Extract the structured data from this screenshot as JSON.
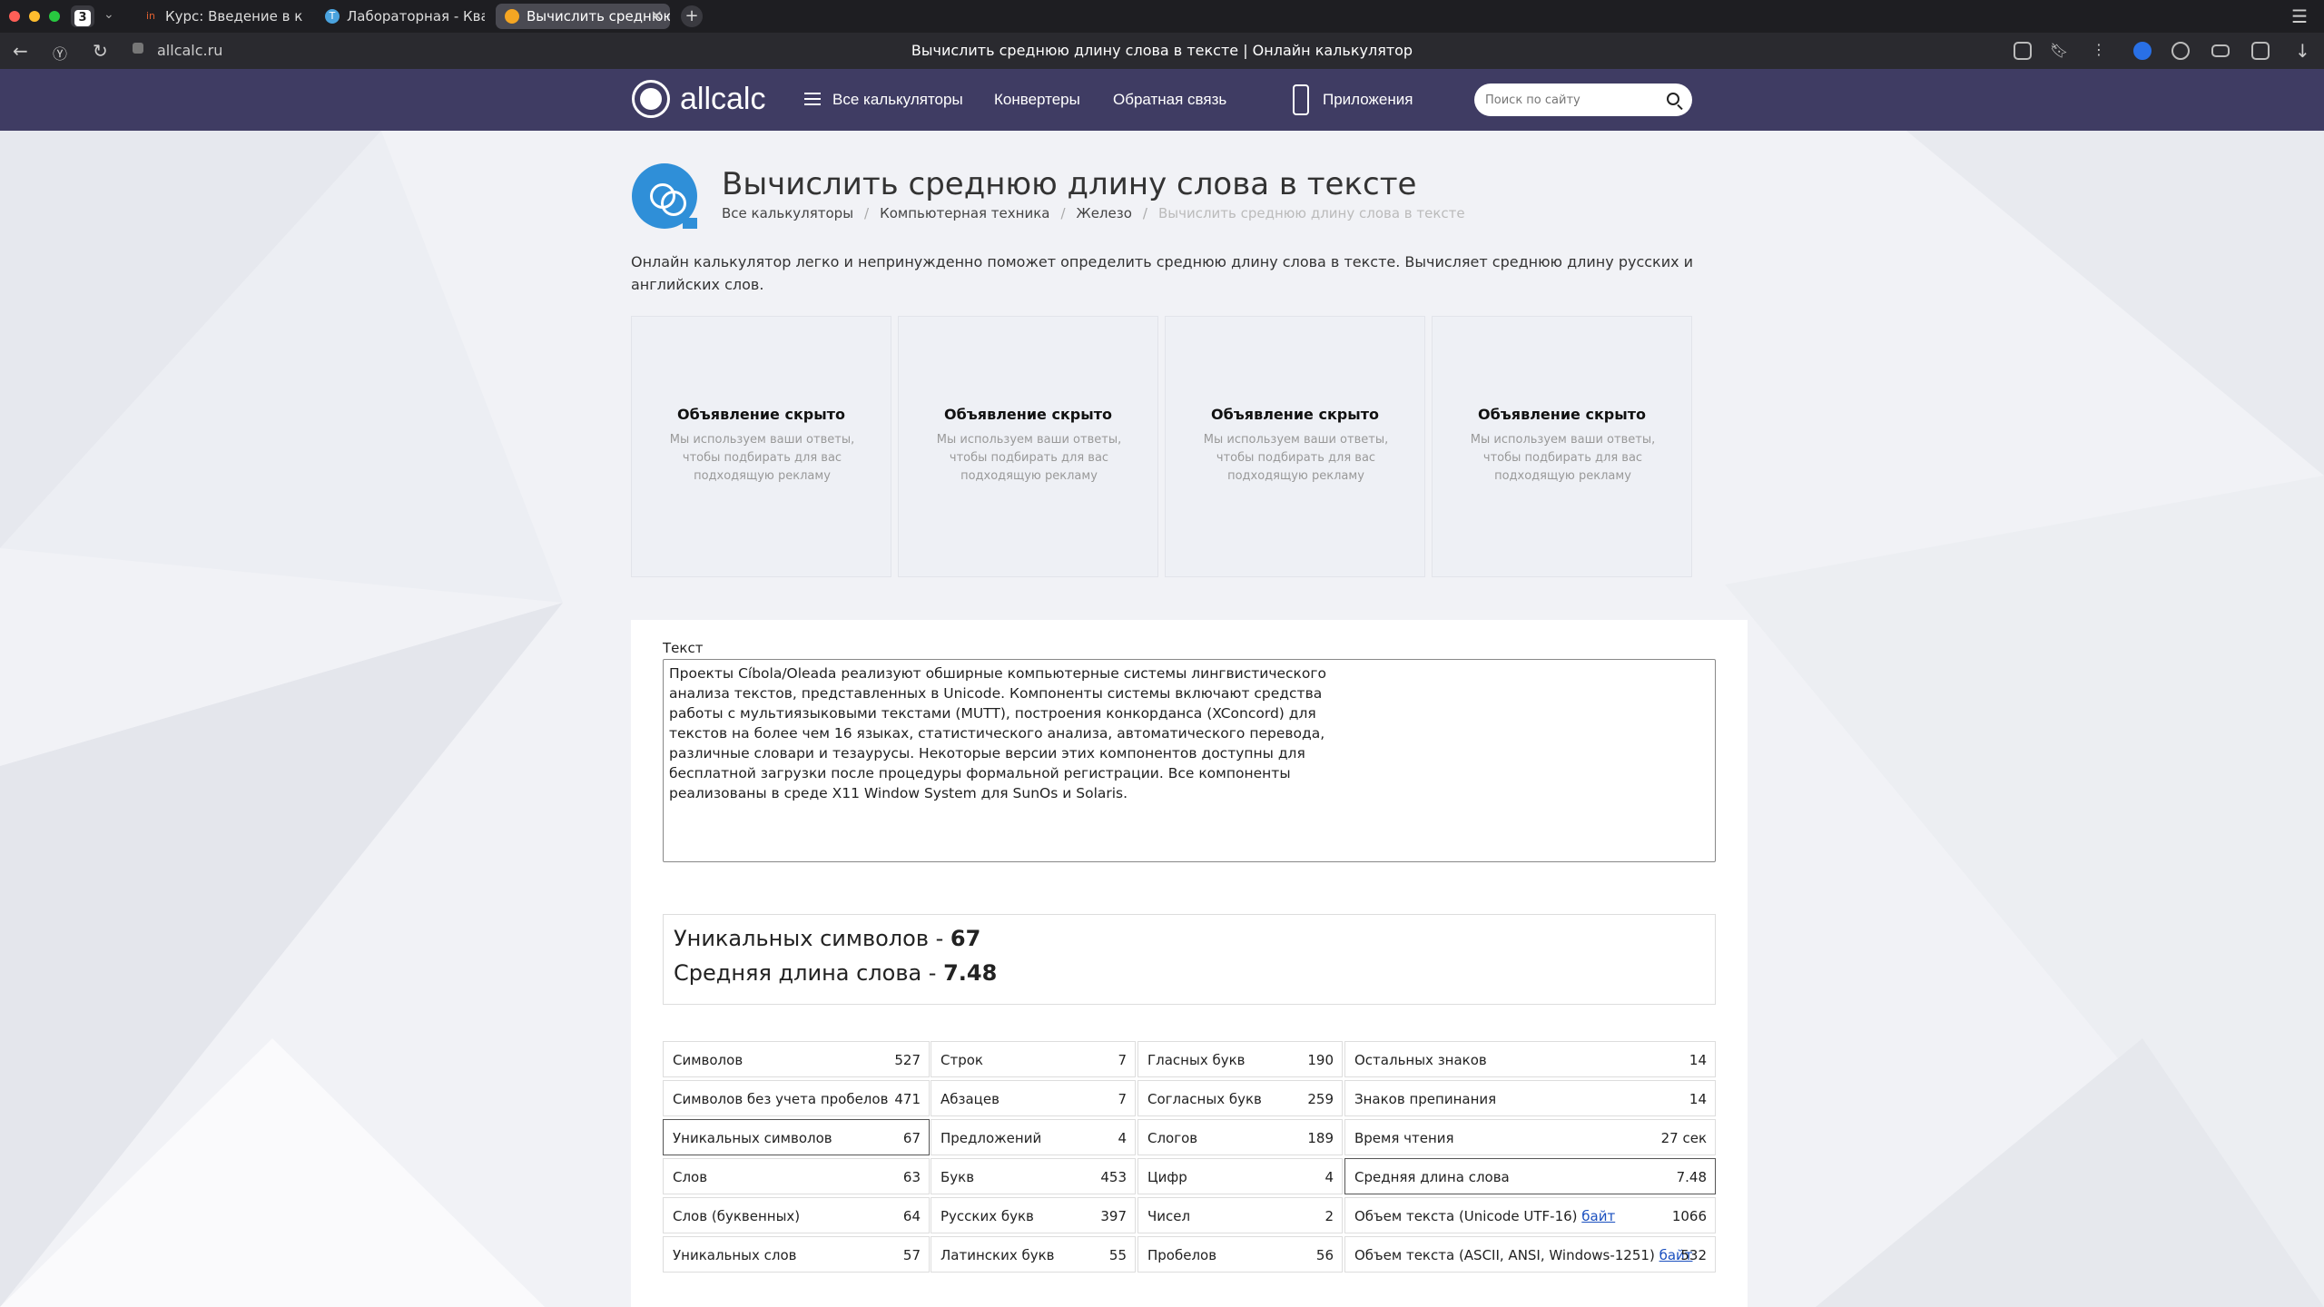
{
  "browser": {
    "tab_count": "3",
    "tabs": [
      {
        "label": "Курс: Введение в компьютерную лингвистику"
      },
      {
        "label": "Лабораторная - Квантитативные"
      },
      {
        "label": "Вычислить среднюю длину"
      }
    ],
    "url": "allcalc.ru",
    "page_title": "Вычислить среднюю длину слова в тексте | Онлайн калькулятор"
  },
  "header": {
    "logo": "allcalc",
    "nav": {
      "all": "Все калькуляторы",
      "converters": "Конвертеры",
      "feedback": "Обратная связь",
      "apps": "Приложения"
    },
    "search_placeholder": "Поиск по сайту"
  },
  "page": {
    "title": "Вычислить среднюю длину слова в тексте",
    "breadcrumb": [
      "Все калькуляторы",
      "Компьютерная техника",
      "Железо",
      "Вычислить среднюю длину слова в тексте"
    ],
    "intro": "Онлайн калькулятор легко и непринужденно поможет определить среднюю длину слова в тексте. Вычисляет среднюю длину русских и английских слов."
  },
  "ads": {
    "title": "Объявление скрыто",
    "text": "Мы используем ваши ответы, чтобы подбирать для вас подходящую рекламу"
  },
  "form": {
    "text_label": "Текст",
    "text_value": "Проекты Cíbola/Oleada реализуют обширные компьютерные системы лингвистического\nанализа текстов, представленных в Unicode. Компоненты системы включают средства\nработы с мультиязыковыми текстами (MUTT), построения конкорданса (XConcord) для\nтекстов на более чем 16 языках, статистического анализа, автоматического перевода,\nразличные словари и тезаурусы. Некоторые версии этих компонентов доступны для\nбесплатной загрузки после процедуры формальной регистрации. Все компоненты\nреализованы в среде X11 Window System для SunOs и Solaris."
  },
  "results": {
    "unique_label": "Уникальных символов - ",
    "unique_value": "67",
    "avg_label": "Средняя длина слова - ",
    "avg_value": "7.48"
  },
  "stats": {
    "col1": [
      {
        "k": "Символов",
        "v": "527"
      },
      {
        "k": "Символов без учета пробелов",
        "v": "471"
      },
      {
        "k": "Уникальных символов",
        "v": "67"
      },
      {
        "k": "Слов",
        "v": "63"
      },
      {
        "k": "Слов (буквенных)",
        "v": "64"
      },
      {
        "k": "Уникальных слов",
        "v": "57"
      }
    ],
    "col2": [
      {
        "k": "Строк",
        "v": "7"
      },
      {
        "k": "Абзацев",
        "v": "7"
      },
      {
        "k": "Предложений",
        "v": "4"
      },
      {
        "k": "Букв",
        "v": "453"
      },
      {
        "k": "Русских букв",
        "v": "397"
      },
      {
        "k": "Латинских букв",
        "v": "55"
      }
    ],
    "col3": [
      {
        "k": "Гласных букв",
        "v": "190"
      },
      {
        "k": "Согласных букв",
        "v": "259"
      },
      {
        "k": "Слогов",
        "v": "189"
      },
      {
        "k": "Цифр",
        "v": "4"
      },
      {
        "k": "Чисел",
        "v": "2"
      },
      {
        "k": "Пробелов",
        "v": "56"
      }
    ],
    "col4": [
      {
        "k": "Остальных знаков",
        "v": "14"
      },
      {
        "k": "Знаков препинания",
        "v": "14"
      },
      {
        "k": "Время чтения",
        "v": "27 сек"
      },
      {
        "k": "Средняя длина слова",
        "v": "7.48"
      },
      {
        "k": "Объем текста (Unicode UTF-16) ",
        "link": "байт",
        "v": "1066"
      },
      {
        "k": "Объем текста (ASCII, ANSI, Windows-1251) ",
        "link": "байт",
        "v": "532"
      }
    ]
  },
  "colors": {
    "header_bg": "#3f3c63",
    "accent_blue": "#2f8fd8",
    "link": "#1a4fbf"
  }
}
